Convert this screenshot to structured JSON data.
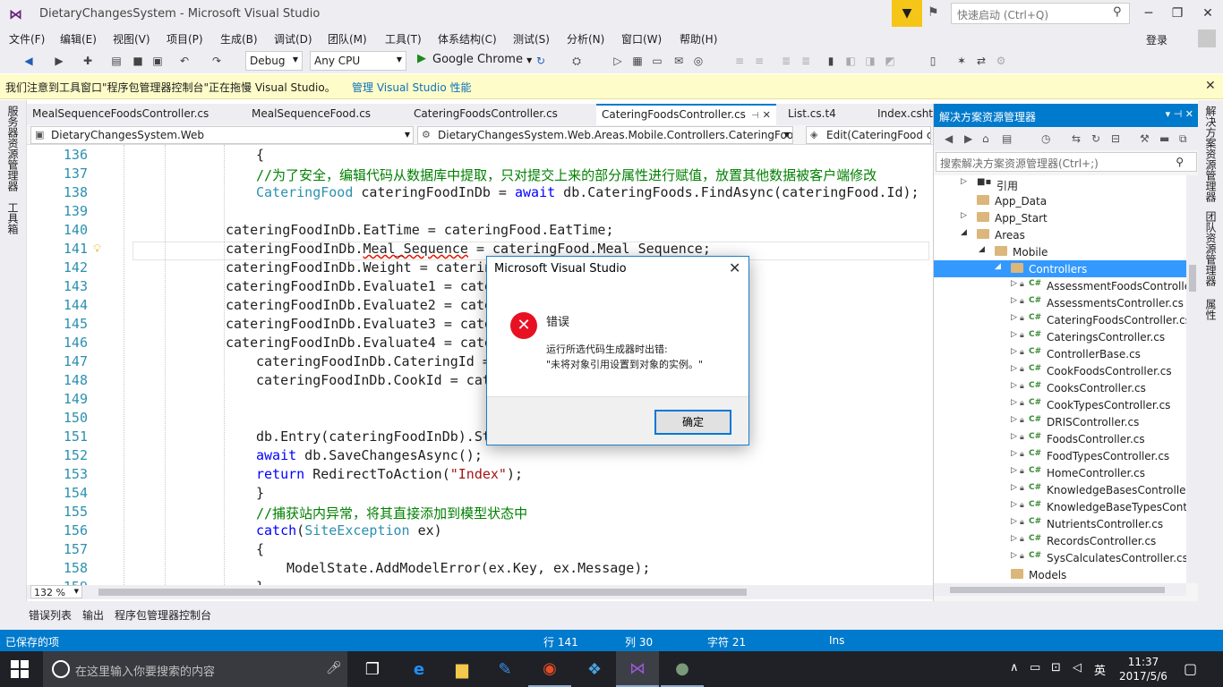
{
  "window": {
    "title": "DietaryChangesSystem - Microsoft Visual Studio",
    "quick_launch_placeholder": "快速启动 (Ctrl+Q)",
    "sign_in": "登录",
    "minimize": "─",
    "restore": "❐",
    "close": "✕"
  },
  "menu": [
    {
      "label": "文件(F)"
    },
    {
      "label": "编辑(E)"
    },
    {
      "label": "视图(V)"
    },
    {
      "label": "项目(P)"
    },
    {
      "label": "生成(B)"
    },
    {
      "label": "调试(D)"
    },
    {
      "label": "团队(M)"
    },
    {
      "label": "工具(T)"
    },
    {
      "label": "体系结构(C)"
    },
    {
      "label": "测试(S)"
    },
    {
      "label": "分析(N)"
    },
    {
      "label": "窗口(W)"
    },
    {
      "label": "帮助(H)"
    }
  ],
  "toolbar": {
    "config": "Debug",
    "platform": "Any CPU",
    "run_target": "Google Chrome"
  },
  "infobar": {
    "message": "我们注意到工具窗口\"程序包管理器控制台\"正在拖慢 Visual Studio。",
    "link": "管理 Visual Studio 性能",
    "close": "✕"
  },
  "left_strip": [
    "服务器资源管理器",
    "工具箱"
  ],
  "right_strip": [
    "解决方案资源管理器",
    "团队资源管理器",
    "属性"
  ],
  "doc_tabs": [
    {
      "label": "MealSequenceFoodsController.cs"
    },
    {
      "label": "MealSequenceFood.cs"
    },
    {
      "label": "CateringFoodsController.cs"
    },
    {
      "label": "CateringFoodsController.cs",
      "active": true
    },
    {
      "label": "List.cs.t4"
    },
    {
      "label": "Index.cshtml"
    }
  ],
  "navbar": {
    "project": "DietaryChangesSystem.Web",
    "type": "DietaryChangesSystem.Web.Areas.Mobile.Controllers.CateringFoodsController",
    "member": "Edit(CateringFood cateringFood)"
  },
  "code": {
    "lines": [
      {
        "n": "136",
        "indent": 2,
        "parts": [
          {
            "t": "{"
          }
        ]
      },
      {
        "n": "137",
        "indent": 2,
        "parts": [
          {
            "t": "//为了安全，编辑代码从数据库中提取，只对提交上来的部分属性进行赋值，放置其他数据被客户端修改",
            "c": "cm"
          }
        ]
      },
      {
        "n": "138",
        "indent": 2,
        "parts": [
          {
            "t": "CateringFood",
            "c": "ty"
          },
          {
            "t": " cateringFoodInDb = "
          },
          {
            "t": "await",
            "c": "kw"
          },
          {
            "t": " db.CateringFoods.FindAsync(cateringFood.Id);"
          }
        ]
      },
      {
        "n": "139",
        "indent": 2,
        "parts": [
          {
            "t": ""
          }
        ]
      },
      {
        "n": "140",
        "indent": 1,
        "parts": [
          {
            "t": "cateringFoodInDb.EatTime = cateringFood.EatTime;"
          }
        ]
      },
      {
        "n": "141",
        "indent": 1,
        "parts": [
          {
            "t": "cateringFoodInDb."
          },
          {
            "t": "Meal_Sequence",
            "c": "squiggle"
          },
          {
            "t": " = cateringFood.Meal_Sequence;"
          }
        ],
        "bulb": true,
        "current": true
      },
      {
        "n": "142",
        "indent": 1,
        "parts": [
          {
            "t": "cateringFoodInDb.Weight = catering"
          }
        ]
      },
      {
        "n": "143",
        "indent": 1,
        "parts": [
          {
            "t": "cateringFoodInDb.Evaluate1 = cater"
          }
        ]
      },
      {
        "n": "144",
        "indent": 1,
        "parts": [
          {
            "t": "cateringFoodInDb.Evaluate2 = cater"
          }
        ]
      },
      {
        "n": "145",
        "indent": 1,
        "parts": [
          {
            "t": "cateringFoodInDb.Evaluate3 = cater"
          }
        ]
      },
      {
        "n": "146",
        "indent": 1,
        "parts": [
          {
            "t": "cateringFoodInDb.Evaluate4 = cater"
          }
        ]
      },
      {
        "n": "147",
        "indent": 2,
        "parts": [
          {
            "t": "cateringFoodInDb.CateringId = "
          }
        ]
      },
      {
        "n": "148",
        "indent": 2,
        "parts": [
          {
            "t": "cateringFoodInDb.CookId = cate"
          }
        ]
      },
      {
        "n": "149",
        "indent": 2,
        "parts": [
          {
            "t": ""
          }
        ]
      },
      {
        "n": "150",
        "indent": 2,
        "parts": [
          {
            "t": ""
          }
        ]
      },
      {
        "n": "151",
        "indent": 2,
        "parts": [
          {
            "t": "db.Entry(cateringFoodInDb).Sta"
          }
        ]
      },
      {
        "n": "152",
        "indent": 2,
        "parts": [
          {
            "t": "await",
            "c": "kw"
          },
          {
            "t": " db.SaveChangesAsync();"
          }
        ]
      },
      {
        "n": "153",
        "indent": 2,
        "parts": [
          {
            "t": "return",
            "c": "kw"
          },
          {
            "t": " RedirectToAction("
          },
          {
            "t": "\"Index\"",
            "c": "st"
          },
          {
            "t": ");"
          }
        ]
      },
      {
        "n": "154",
        "indent": 2,
        "parts": [
          {
            "t": "}"
          }
        ]
      },
      {
        "n": "155",
        "indent": 2,
        "parts": [
          {
            "t": "//捕获站内异常，将其直接添加到模型状态中",
            "c": "cm"
          }
        ]
      },
      {
        "n": "156",
        "indent": 2,
        "parts": [
          {
            "t": "catch",
            "c": "kw"
          },
          {
            "t": "("
          },
          {
            "t": "SiteException",
            "c": "ty"
          },
          {
            "t": " ex)"
          }
        ]
      },
      {
        "n": "157",
        "indent": 2,
        "parts": [
          {
            "t": "{"
          }
        ]
      },
      {
        "n": "158",
        "indent": 3,
        "parts": [
          {
            "t": "ModelState.AddModelError(ex.Key, ex.Message);"
          }
        ]
      },
      {
        "n": "159",
        "indent": 2,
        "parts": [
          {
            "t": "}"
          }
        ]
      }
    ]
  },
  "zoom": "132 %",
  "solution_explorer": {
    "title": "解决方案资源管理器",
    "search_placeholder": "搜索解决方案资源管理器(Ctrl+;)",
    "items": [
      {
        "label": "引用",
        "level": 1,
        "kind": "ref",
        "exp": "▷"
      },
      {
        "label": "App_Data",
        "level": 1,
        "kind": "folder",
        "exp": ""
      },
      {
        "label": "App_Start",
        "level": 1,
        "kind": "folder",
        "exp": "▷"
      },
      {
        "label": "Areas",
        "level": 1,
        "kind": "folder",
        "exp": "◢"
      },
      {
        "label": "Mobile",
        "level": 2,
        "kind": "folder",
        "exp": "◢"
      },
      {
        "label": "Controllers",
        "level": 3,
        "kind": "folder",
        "exp": "◢",
        "selected": true
      },
      {
        "label": "AssessmentFoodsController.cs",
        "level": 4,
        "kind": "cs",
        "exp": "▷"
      },
      {
        "label": "AssessmentsController.cs",
        "level": 4,
        "kind": "cs",
        "exp": "▷"
      },
      {
        "label": "CateringFoodsController.cs",
        "level": 4,
        "kind": "cs",
        "exp": "▷"
      },
      {
        "label": "CateringsController.cs",
        "level": 4,
        "kind": "cs",
        "exp": "▷"
      },
      {
        "label": "ControllerBase.cs",
        "level": 4,
        "kind": "cs",
        "exp": "▷"
      },
      {
        "label": "CookFoodsController.cs",
        "level": 4,
        "kind": "cs",
        "exp": "▷"
      },
      {
        "label": "CooksController.cs",
        "level": 4,
        "kind": "cs",
        "exp": "▷"
      },
      {
        "label": "CookTypesController.cs",
        "level": 4,
        "kind": "cs",
        "exp": "▷"
      },
      {
        "label": "DRISController.cs",
        "level": 4,
        "kind": "cs",
        "exp": "▷"
      },
      {
        "label": "FoodsController.cs",
        "level": 4,
        "kind": "cs",
        "exp": "▷"
      },
      {
        "label": "FoodTypesController.cs",
        "level": 4,
        "kind": "cs",
        "exp": "▷"
      },
      {
        "label": "HomeController.cs",
        "level": 4,
        "kind": "cs",
        "exp": "▷"
      },
      {
        "label": "KnowledgeBasesController.cs",
        "level": 4,
        "kind": "cs",
        "exp": "▷"
      },
      {
        "label": "KnowledgeBaseTypesController.cs",
        "level": 4,
        "kind": "cs",
        "exp": "▷"
      },
      {
        "label": "NutrientsController.cs",
        "level": 4,
        "kind": "cs",
        "exp": "▷"
      },
      {
        "label": "RecordsController.cs",
        "level": 4,
        "kind": "cs",
        "exp": "▷"
      },
      {
        "label": "SysCalculatesController.cs",
        "level": 4,
        "kind": "cs",
        "exp": "▷"
      },
      {
        "label": "Models",
        "level": 3,
        "kind": "folder",
        "exp": ""
      }
    ]
  },
  "bottom_tabs": [
    {
      "label": "错误列表"
    },
    {
      "label": "输出"
    },
    {
      "label": "程序包管理器控制台"
    }
  ],
  "status": {
    "message": "已保存的项",
    "line": "行 141",
    "col": "列 30",
    "ch": "字符 21",
    "ins": "Ins"
  },
  "taskbar": {
    "search_placeholder": "在这里输入你要搜索的内容",
    "ime": "英",
    "time": "11:37",
    "date": "2017/5/6"
  },
  "dialog": {
    "title": "Microsoft Visual Studio",
    "heading": "错误",
    "line1": "运行所选代码生成器时出错:",
    "line2": "\"未将对象引用设置到对象的实例。\"",
    "ok": "确定"
  },
  "colors": {
    "accent": "#007acc",
    "error": "#e81123",
    "selection": "#3399ff"
  }
}
